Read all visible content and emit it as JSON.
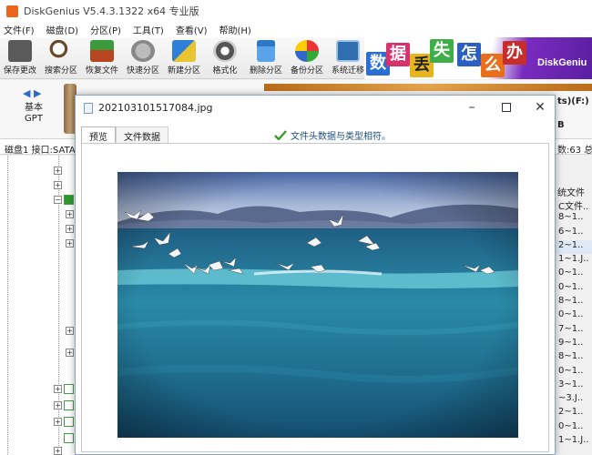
{
  "app": {
    "title": "DiskGenius V5.4.3.1322 x64 专业版"
  },
  "menu": [
    "文件(F)",
    "磁盘(D)",
    "分区(P)",
    "工具(T)",
    "查看(V)",
    "帮助(H)"
  ],
  "toolbar": {
    "buttons": [
      {
        "label": "保存更改",
        "icon": "save-icon"
      },
      {
        "label": "搜索分区",
        "icon": "search-partition-icon"
      },
      {
        "label": "恢复文件",
        "icon": "recover-files-icon"
      },
      {
        "label": "快速分区",
        "icon": "quick-partition-icon"
      },
      {
        "label": "新建分区",
        "icon": "new-partition-icon"
      },
      {
        "label": "格式化",
        "icon": "format-icon"
      },
      {
        "label": "删除分区",
        "icon": "delete-partition-icon"
      },
      {
        "label": "备份分区",
        "icon": "backup-partition-icon"
      },
      {
        "label": "系统迁移",
        "icon": "system-migration-icon"
      }
    ],
    "banner": {
      "chars": [
        "数",
        "据",
        "丢",
        "失",
        "怎",
        "么",
        "办"
      ],
      "brand": "DiskGeniu"
    }
  },
  "disk": {
    "label_line1": "基本",
    "label_line2": "GPT",
    "right_fragment_top": "ts)(F:)",
    "right_fragment_bottom": "B"
  },
  "infobar": {
    "left": "磁盘1 接口:SATA",
    "right": "数:63  总"
  },
  "right_list": {
    "header": "统文件",
    "items": [
      "C文件..",
      "8~1..",
      "6~1..",
      "2~1..",
      "1~1.J..",
      "0~1..",
      "0~1..",
      "8~1..",
      "0~1..",
      "7~1..",
      "9~1..",
      "8~1..",
      "0~1..",
      "3~1..",
      "~3.J..",
      "2~1..",
      "0~1..",
      "1~1.J.."
    ]
  },
  "dialog": {
    "title": "20210310151708­4.jpg",
    "tabs": [
      "预览",
      "文件数据"
    ],
    "status": "文件头数据与类型相符。",
    "colors": {
      "status": "#1f4e79",
      "check": "#3a9a2a"
    }
  }
}
